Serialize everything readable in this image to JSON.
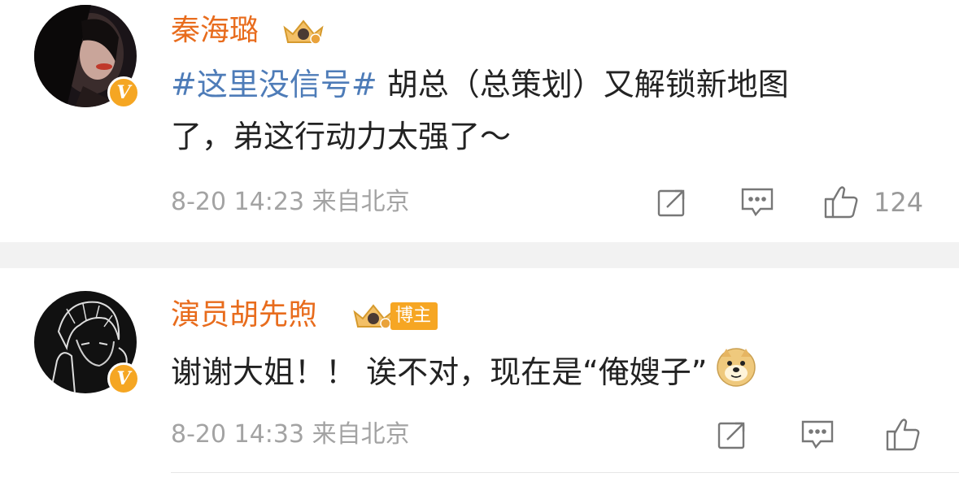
{
  "comments": [
    {
      "username": "秦海璐",
      "hashtag": "#这里没信号#",
      "text_line1": " 胡总（总策划）又解锁新地图",
      "text_line2": "了，弟这行动力太强了～",
      "timestamp": "8-20 14:23",
      "source": "来自北京",
      "like_count": "124",
      "verified": true,
      "level_icon": "crown-icon"
    },
    {
      "username": "演员胡先煦",
      "blogger_tag": "博主",
      "text": "谢谢大姐！！ 诶不对，现在是“俺嫂子”",
      "emoji": "doge-emoji",
      "timestamp": "8-20 14:33",
      "source": "来自北京",
      "verified": true,
      "level_icon": "crown-icon"
    }
  ],
  "icons": {
    "repost": "repost-icon",
    "comment": "comment-icon",
    "like": "thumbs-up-icon"
  },
  "colors": {
    "username": "#e86c1d",
    "hashtag": "#4e7cb8",
    "meta": "#a3a3a3",
    "badge": "#f5a623",
    "separator": "#f2f2f2"
  }
}
